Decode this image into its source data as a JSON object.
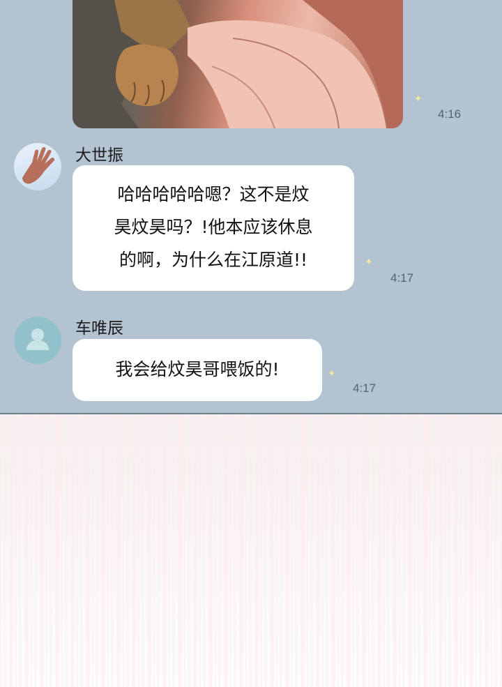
{
  "messages": [
    {
      "type": "image",
      "time": "4:16"
    },
    {
      "sender": "大世振",
      "avatar": "hand-photo-avatar",
      "lines": [
        "哈哈哈哈哈嗯？这不是炆",
        "昊炆昊吗？!他本应该休息",
        "的啊，为什么在江原道!!"
      ],
      "time": "4:17"
    },
    {
      "sender": "车唯辰",
      "avatar": "default-user-avatar",
      "lines": [
        "我会给炆昊哥喂饭的!"
      ],
      "time": "4:17"
    }
  ],
  "colors": {
    "chat_background": "#b3c3d1",
    "bubble": "#ffffff",
    "default_avatar": "#93c1c9"
  }
}
